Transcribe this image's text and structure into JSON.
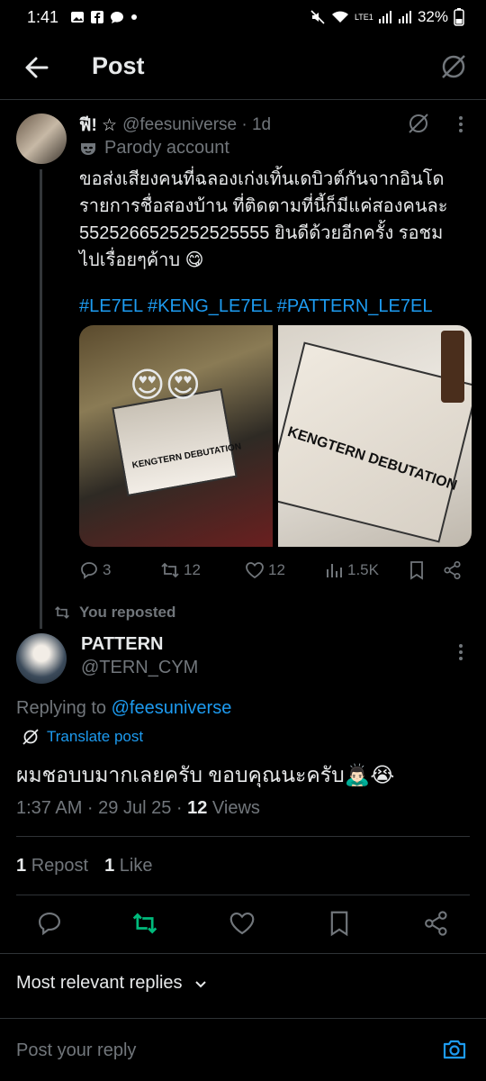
{
  "status_bar": {
    "time": "1:41",
    "battery": "32%",
    "network": "LTE1"
  },
  "header": {
    "title": "Post"
  },
  "original_post": {
    "display_name": "ฟี! ☆",
    "handle_time": "@feesuniverse · 1d",
    "parody_label": "Parody account",
    "text": "ขอส่งเสียงคนที่ฉลองเก่งเทิ้นเดบิวต์กันจากอินโด\nรายการชื่อสองบ้าน ที่ติดตามที่นี้ก็มีแค่สองคนละ\n5525266525252525555 ยินดีด้วยอีกครั้ง รอชม\nไปเรื่อยๆค้าบ 😋",
    "hashtags": "#LE7EL #KENG_LE7EL #PATTERN_LE7EL",
    "media_caption_left": "KENGTERN DEBUTATION",
    "media_caption_right": "KENGTERN DEBUTATION",
    "stats": {
      "replies": "3",
      "reposts": "12",
      "likes": "12",
      "views": "1.5K"
    }
  },
  "repost_banner": "You reposted",
  "main_post": {
    "display_name": "PATTERN",
    "handle": "@TERN_CYM",
    "replying_prefix": "Replying to ",
    "replying_handle": "@feesuniverse",
    "translate_label": "Translate post",
    "text": "ผมชอบบมากเลยครับ ขอบคุณนะครับ🙇🏻‍♂️😭",
    "time": "1:37 AM · 29 Jul 25 · ",
    "views_count": "12",
    "views_label": " Views",
    "repost_count": "1",
    "repost_label": "Repost",
    "like_count": "1",
    "like_label": "Like"
  },
  "replies_sort": "Most relevant replies",
  "reply_input": {
    "placeholder": "Post your reply"
  },
  "colors": {
    "background": "#000000",
    "accent": "#1d9bf0",
    "repost_green": "#00ba7c",
    "muted": "#71767b"
  }
}
